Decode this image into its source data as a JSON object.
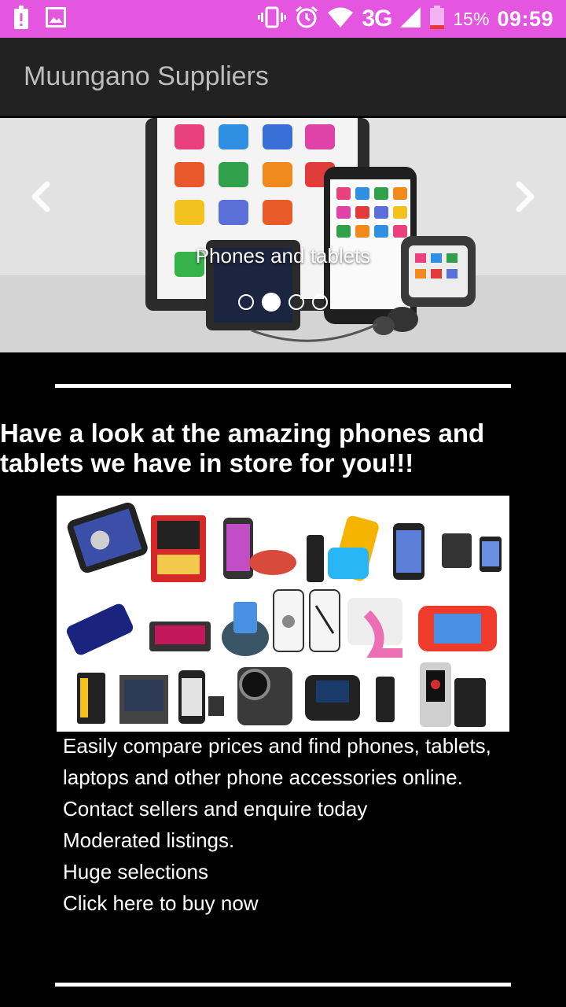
{
  "status_bar": {
    "network": "3G",
    "battery_percent": "15%",
    "time": "09:59",
    "icons": [
      "alert-icon",
      "image-icon",
      "vibrate-icon",
      "alarm-icon",
      "wifi-icon",
      "signal-icon",
      "battery-icon"
    ],
    "color": "#e455e0"
  },
  "app_bar": {
    "title": "Muungano Suppliers",
    "color": "#222222"
  },
  "carousel": {
    "caption": "Phones and tablets",
    "slide_count": 4,
    "active_index": 1,
    "prev_icon": "chevron-left-icon",
    "next_icon": "chevron-right-icon"
  },
  "main": {
    "headline": "Have a look at the amazing phones and tablets we have in store for you!!!",
    "description_lines": [
      "Easily compare prices and find phones, tablets, laptops and other phone accessories online.",
      "Contact sellers and enquire today",
      "Moderated listings.",
      "Huge selections",
      "Click here to buy now"
    ]
  }
}
